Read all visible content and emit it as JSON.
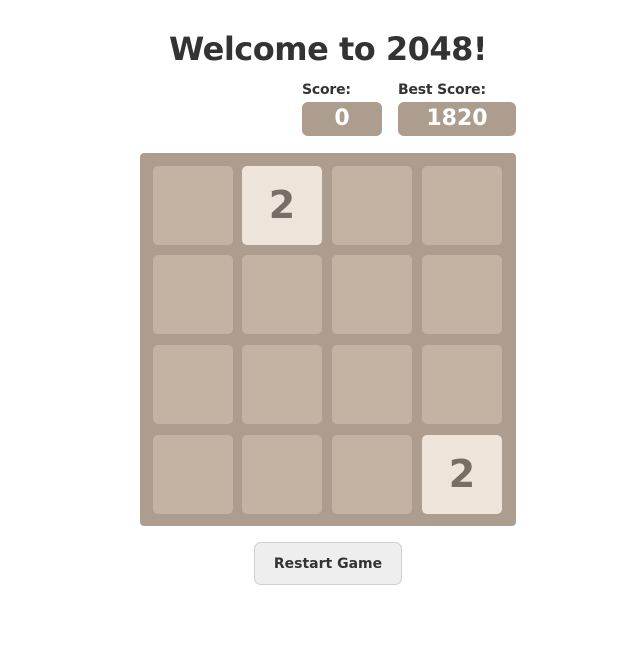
{
  "header": {
    "title": "Welcome to 2048!"
  },
  "scores": {
    "current_label": "Score:",
    "current_value": "0",
    "best_label": "Best Score:",
    "best_value": "1820"
  },
  "board": {
    "size": 4,
    "cells": [
      [
        "",
        "2",
        "",
        ""
      ],
      [
        "",
        "",
        "",
        ""
      ],
      [
        "",
        "",
        "",
        ""
      ],
      [
        "",
        "",
        "",
        "2"
      ]
    ]
  },
  "controls": {
    "restart_label": "Restart Game"
  },
  "colors": {
    "board_bg": "#ad9d8f",
    "empty_cell": "#c2b3a3",
    "tile_2_bg": "#eee4da",
    "tile_text": "#776e65",
    "score_box_bg": "#ad9d8f"
  }
}
